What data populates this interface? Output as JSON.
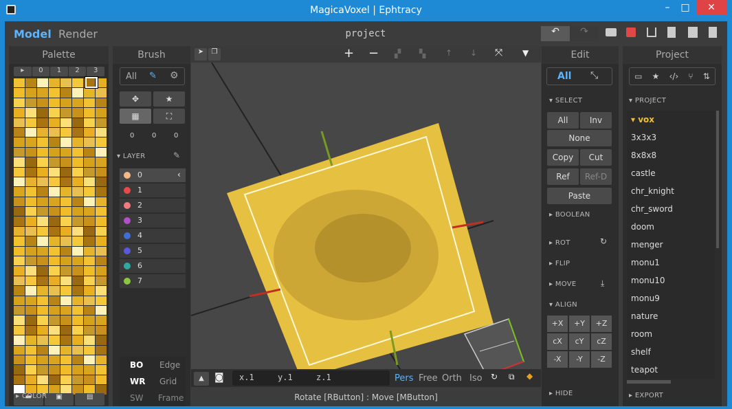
{
  "title": "MagicaVoxel | Ephtracy",
  "window_controls": {
    "minimize": "–",
    "maximize": "□",
    "close": "✕"
  },
  "modes": {
    "model": "Model",
    "render": "Render"
  },
  "project_name": "project",
  "palette": {
    "title": "Palette",
    "tabs": [
      "▸",
      "0",
      "1",
      "2",
      "3"
    ],
    "footer_label": "COLOR",
    "colors": [
      "#f2c230",
      "#e8b020",
      "#d6a21c",
      "#f5c83a",
      "#c8921a",
      "#e6b42a",
      "#f8d24a",
      "#b88415",
      "#fbe07a",
      "#d9a41e",
      "#a87412",
      "#f0bc28",
      "#e9c050",
      "#c59a2a",
      "#fff2b8",
      "#996910"
    ]
  },
  "brush": {
    "title": "Brush",
    "all_label": "All",
    "coords": [
      "0",
      "0",
      "0"
    ],
    "layer_label": "LAYER",
    "layers": [
      {
        "num": "0",
        "color": "#f5b88a"
      },
      {
        "num": "1",
        "color": "#e84a4a"
      },
      {
        "num": "2",
        "color": "#f07a80"
      },
      {
        "num": "3",
        "color": "#b34fc8"
      },
      {
        "num": "4",
        "color": "#3f6ed4"
      },
      {
        "num": "5",
        "color": "#5a5ad8"
      },
      {
        "num": "6",
        "color": "#2fa8a0"
      },
      {
        "num": "7",
        "color": "#8cc63f"
      }
    ],
    "view_opts": [
      {
        "a": "BO",
        "b": "Edge"
      },
      {
        "a": "WR",
        "b": "Grid"
      },
      {
        "a": "SW",
        "b": "Frame"
      }
    ]
  },
  "viewport": {
    "toolbar_plus": "+",
    "toolbar_minus": "−",
    "toolbar_down": "▼",
    "coords": {
      "x": "x.1",
      "y": "y.1",
      "z": "z.1"
    },
    "views": [
      "Pers",
      "Free",
      "Orth",
      "Iso"
    ],
    "status": "Rotate [RButton] : Move [MButton]"
  },
  "edit": {
    "title": "Edit",
    "all_label": "All",
    "select_label": "SELECT",
    "select_buttons": [
      [
        "All",
        "Inv"
      ],
      [
        "None"
      ],
      [
        "Copy",
        "Cut"
      ],
      [
        "Ref",
        "Ref-D"
      ],
      [
        "Paste"
      ]
    ],
    "sections": [
      "BOOLEAN",
      "ROT",
      "FLIP",
      "MOVE",
      "ALIGN"
    ],
    "align_grid": [
      [
        "+X",
        "+Y",
        "+Z"
      ],
      [
        "cX",
        "cY",
        "cZ"
      ],
      [
        "-X",
        "-Y",
        "-Z"
      ]
    ],
    "hide_label": "HIDE"
  },
  "project": {
    "title": "Project",
    "section": "PROJECT",
    "items": [
      "vox",
      "3x3x3",
      "8x8x8",
      "castle",
      "chr_knight",
      "chr_sword",
      "doom",
      "menger",
      "monu1",
      "monu10",
      "monu9",
      "nature",
      "room",
      "shelf",
      "teapot"
    ],
    "export_label": "EXPORT"
  }
}
